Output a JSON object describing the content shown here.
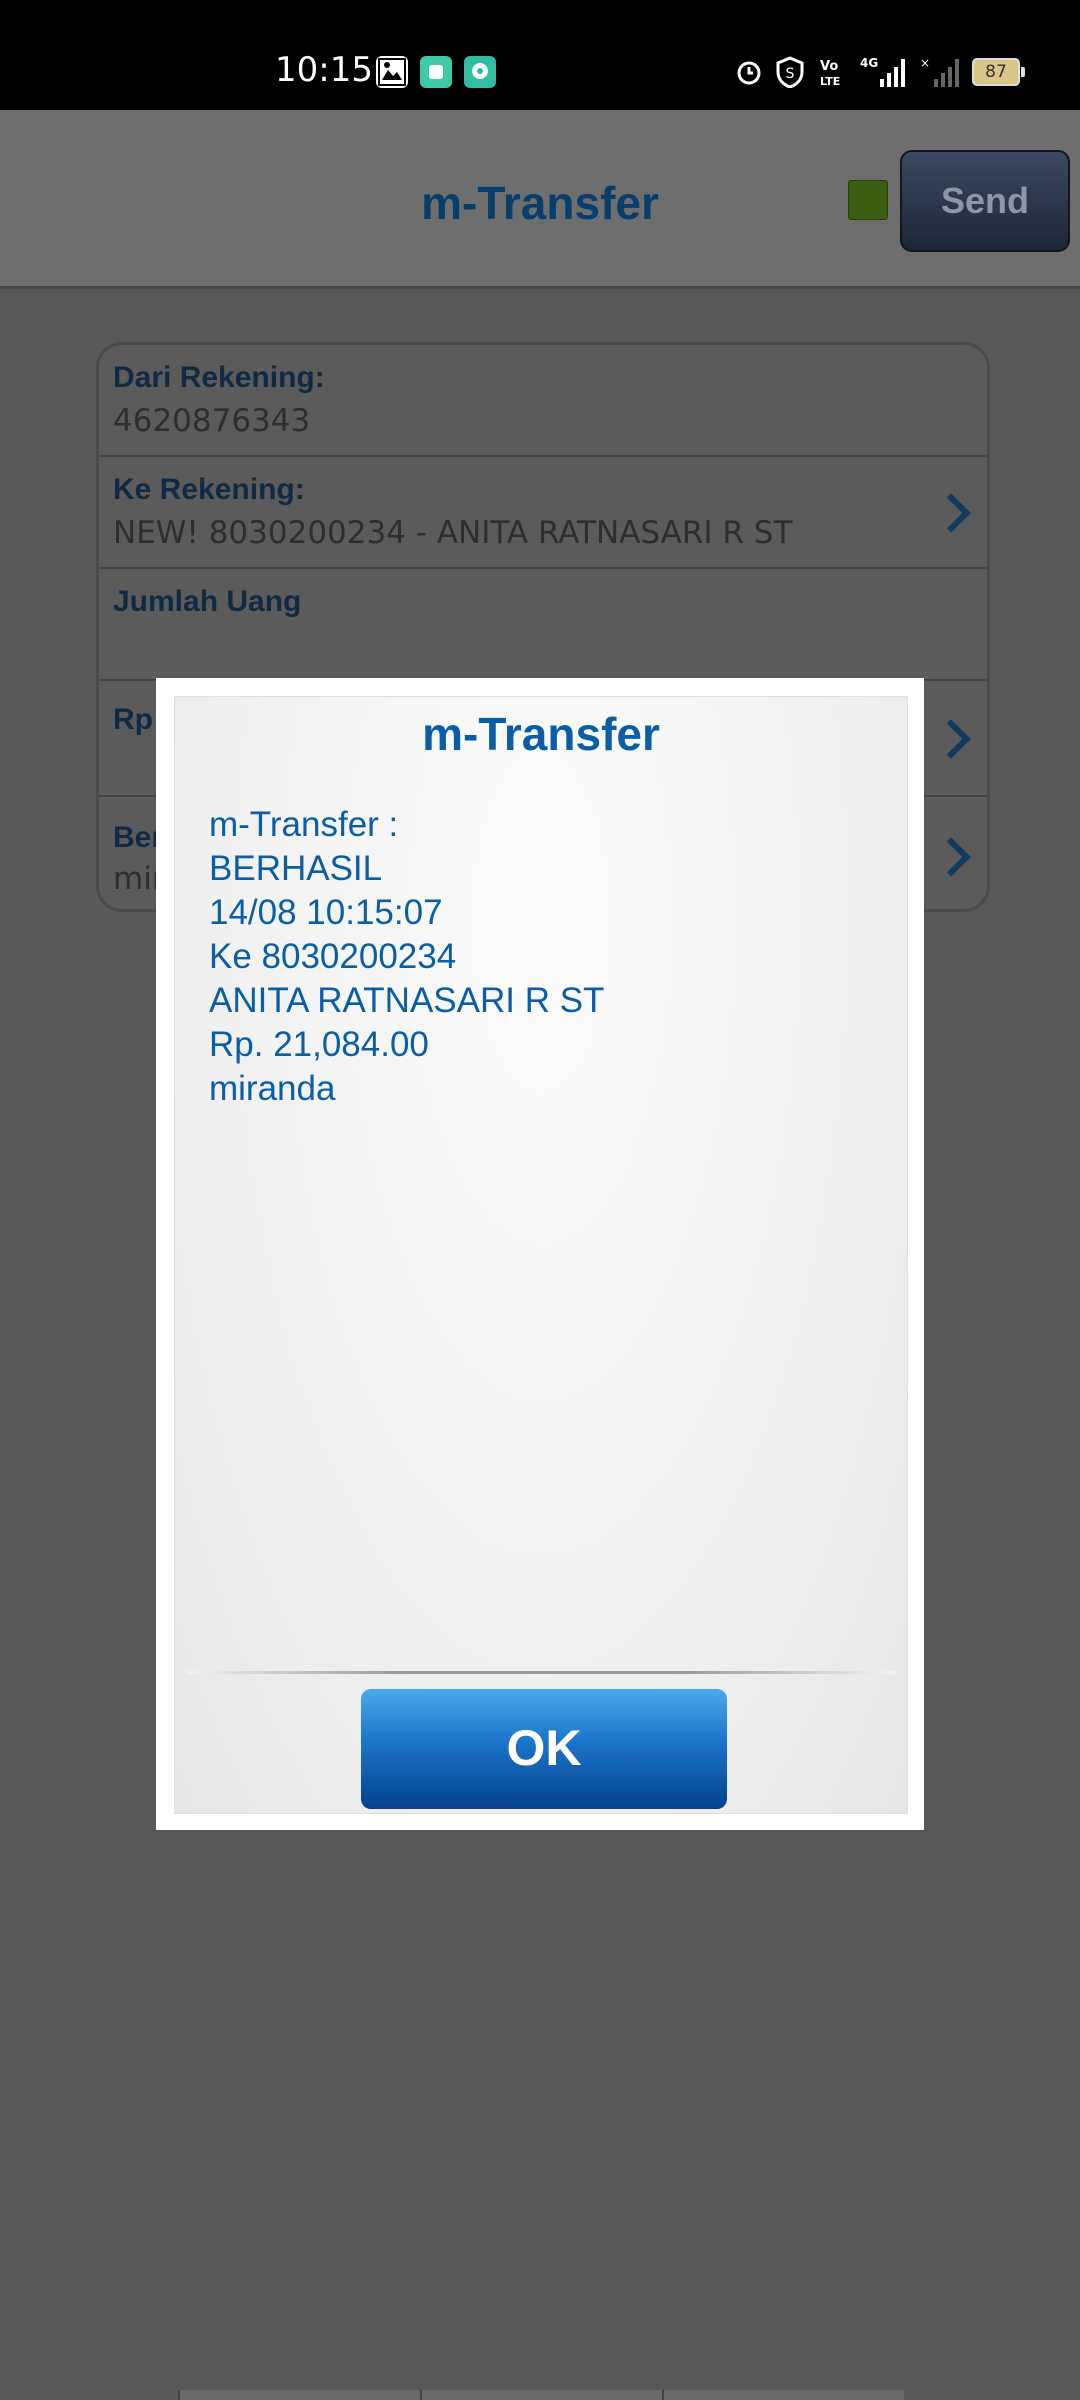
{
  "status_bar": {
    "time": "10:15",
    "battery": "87",
    "icons": [
      "gallery-icon",
      "chat-icon",
      "message-icon",
      "alarm-icon",
      "vpn-icon",
      "volte-icon",
      "signal-4g-icon",
      "signal-icon"
    ]
  },
  "header": {
    "title": "m-Transfer",
    "send_label": "Send",
    "status_color": "#3c5e10"
  },
  "form": {
    "from_label": "Dari Rekening:",
    "from_value": "4620876343",
    "to_label": "Ke Rekening:",
    "to_value": "NEW! 8030200234 - ANITA RATNASARI R ST",
    "amount_label": "Jumlah Uang",
    "currency_label": "Rp",
    "note_label": "Ber",
    "note_value": "mir"
  },
  "dialog": {
    "title": "m-Transfer",
    "lines": [
      "m-Transfer :",
      "BERHASIL",
      "14/08 10:15:07",
      "Ke 8030200234",
      "ANITA RATNASARI R ST",
      "Rp. 21,084.00",
      "miranda"
    ],
    "ok_label": "OK"
  },
  "colors": {
    "title_blue": "#0a5ea8",
    "header_blue": "#063e6e",
    "ok_top": "#4aa9ea",
    "ok_bottom": "#06418c"
  }
}
